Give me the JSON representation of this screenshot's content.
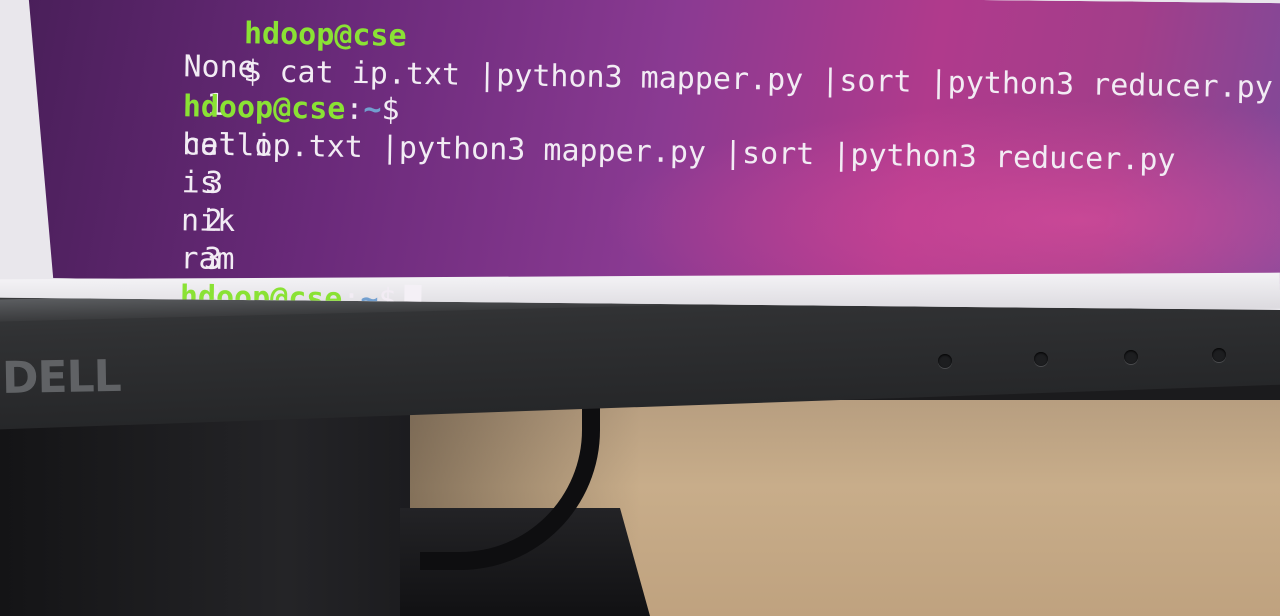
{
  "terminal": {
    "partial_top_line": {
      "prompt_user": "hdoop@cse",
      "command": "$ cat ip.txt |python3 mapper.py |sort |python3 reducer.py"
    },
    "previous_output": [
      {
        "word": "None",
        "count": "1"
      }
    ],
    "command_line": {
      "user_host": "hdoop@cse",
      "colon": ":",
      "path": "~",
      "sign": "$",
      "command": "cat ip.txt |python3 mapper.py |sort |python3 reducer.py"
    },
    "output": [
      {
        "word": "hello",
        "count": "3"
      },
      {
        "word": "is",
        "count": "2"
      },
      {
        "word": "nik",
        "count": "3"
      },
      {
        "word": "ram",
        "count": "3"
      }
    ],
    "final_prompt": {
      "user_host": "hdoop@cse",
      "colon": ":",
      "path": "~",
      "sign": "$"
    },
    "colors": {
      "prompt_user": "#8ae234",
      "prompt_path": "#729fcf",
      "background_left": "#4a1f5a",
      "background_right": "#b03a8c",
      "text": "#f2ecf4"
    }
  },
  "monitor": {
    "brand_logo": "DELL"
  }
}
